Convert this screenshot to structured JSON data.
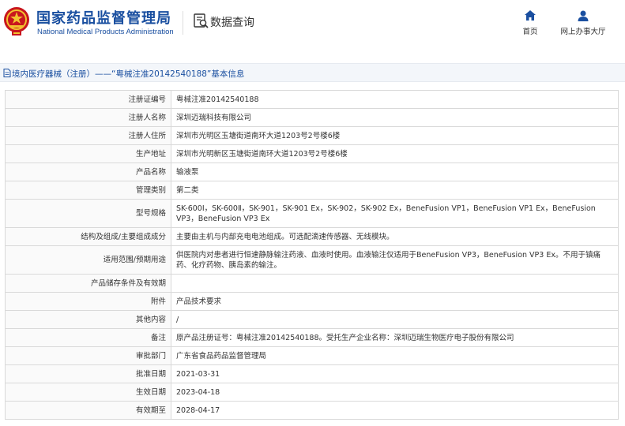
{
  "header": {
    "logo_cn": "国家药品监督管理局",
    "logo_en": "National Medical Products Administration",
    "query_title": "数据查询",
    "nav": {
      "home_label": "首页",
      "office_label": "网上办事大厅"
    }
  },
  "breadcrumb": {
    "text": "境内医疗器械（注册）——“粤械注准20142540188”基本信息"
  },
  "rows": [
    {
      "label": "注册证编号",
      "value": "粤械注准20142540188"
    },
    {
      "label": "注册人名称",
      "value": "深圳迈瑞科技有限公司"
    },
    {
      "label": "注册人住所",
      "value": "深圳市光明区玉塘街道南环大道1203号2号楼6楼"
    },
    {
      "label": "生产地址",
      "value": "深圳市光明新区玉塘街道南环大道1203号2号楼6楼"
    },
    {
      "label": "产品名称",
      "value": "输液泵"
    },
    {
      "label": "管理类别",
      "value": "第二类"
    },
    {
      "label": "型号规格",
      "value": "SK-600Ⅰ，SK-600Ⅱ，SK-901，SK-901 Ex，SK-902，SK-902 Ex，BeneFusion VP1，BeneFusion VP1 Ex，BeneFusion VP3，BeneFusion VP3 Ex"
    },
    {
      "label": "结构及组成/主要组成成分",
      "value": "主要由主机与内部充电电池组成。可选配滴速传感器、无线模块。"
    },
    {
      "label": "适用范围/预期用途",
      "value": "供医院内对患者进行恒速静脉输注药液、血液时使用。血液输注仅适用于BeneFusion VP3，BeneFusion VP3 Ex。不用于镇痛药、化疗药物、胰岛素的输注。"
    },
    {
      "label": "产品储存条件及有效期",
      "value": ""
    },
    {
      "label": "附件",
      "value": "产品技术要求"
    },
    {
      "label": "其他内容",
      "value": "/"
    },
    {
      "label": "备注",
      "value": "原产品注册证号：粤械注准20142540188。受托生产企业名称：深圳迈瑞生物医疗电子股份有限公司"
    },
    {
      "label": "审批部门",
      "value": "广东省食品药品监督管理局"
    },
    {
      "label": "批准日期",
      "value": "2021-03-31"
    },
    {
      "label": "生效日期",
      "value": "2023-04-18"
    },
    {
      "label": "有效期至",
      "value": "2028-04-17"
    }
  ],
  "colors": {
    "brand_blue": "#1a4fa0",
    "emblem_red": "#c8161d",
    "emblem_gold": "#f2c230",
    "border": "#d9d9d9",
    "crumb_bg": "#f3f6fa"
  },
  "icons": [
    "national-emblem-icon",
    "data-query-icon",
    "home-icon",
    "user-icon",
    "document-icon"
  ]
}
